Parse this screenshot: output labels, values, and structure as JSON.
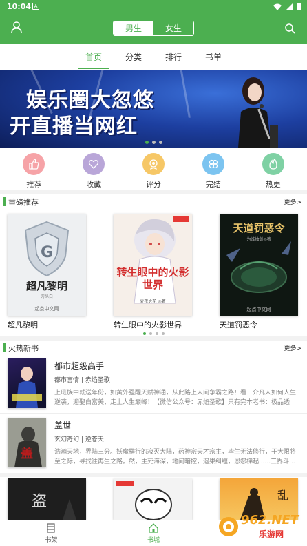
{
  "status_bar": {
    "time": "10:04",
    "notif_letter": "A"
  },
  "header": {
    "gender_male": "男生",
    "gender_female": "女生"
  },
  "tabs": [
    {
      "label": "首页",
      "active": true
    },
    {
      "label": "分类",
      "active": false
    },
    {
      "label": "排行",
      "active": false
    },
    {
      "label": "书单",
      "active": false
    }
  ],
  "banner": {
    "line1": "娱乐圈大忽悠",
    "line2": "开直播当网红",
    "pages": 3,
    "current_page": 1
  },
  "quick_links": [
    {
      "label": "推荐",
      "icon": "thumbs-up-icon",
      "color": "#f6a3a7"
    },
    {
      "label": "收藏",
      "icon": "heart-icon",
      "color": "#b9a6d8"
    },
    {
      "label": "评分",
      "icon": "award-icon",
      "color": "#f6c766"
    },
    {
      "label": "完结",
      "icon": "clover-icon",
      "color": "#7cc4f0"
    },
    {
      "label": "热更",
      "icon": "flame-icon",
      "color": "#7fd1a4"
    }
  ],
  "featured": {
    "title": "重磅推荐",
    "more": "更多>",
    "books": [
      {
        "title": "超凡黎明",
        "cover_title": "超凡黎明",
        "cover_author": "刃纵白",
        "cover_publisher": "起点中文网"
      },
      {
        "title": "转生眼中的火影世界",
        "cover_title": "转生眼中的火影世界",
        "cover_author": "夏夜之花 ◎著",
        "cover_publisher": "起点中文网"
      },
      {
        "title": "天道罚恶令",
        "cover_title": "天道罚恶令",
        "cover_author": "为谁抽剑◎著",
        "cover_publisher": "起点中文网"
      }
    ],
    "pages": 4,
    "current_page": 1
  },
  "new_books": {
    "title": "火热新书",
    "more": "更多>",
    "items": [
      {
        "name": "都市超级高手",
        "meta": "都市言情 | 赤焰圣歌",
        "desc": "上班族中就送年份，如黄外强醒天赋神通，从此路上人间争霸之路！看一介凡人如何人生逆袭，迎娶白富美，走上人生巅峰！【微信公众号：赤焰圣歌】只有完本老书：极品透视..."
      },
      {
        "name": "盖世",
        "meta": "玄幻奇幻 | 逆苍天",
        "desc": "浩瀚天地，界陆三分。妖魔横行的寂灭大陆，药神宗天才宗主，毕生无法修行，于大限将至之际，寻找往再生之路。然，主死海深，地间暗控，遇果纠缠，恩怨梯起......三界斗..."
      }
    ]
  },
  "bottom_nav": [
    {
      "label": "书架",
      "icon": "bookshelf-icon",
      "active": false
    },
    {
      "label": "书城",
      "icon": "home-icon",
      "active": true
    }
  ],
  "watermark": {
    "brand": "962.NET",
    "sub": "乐游网"
  }
}
